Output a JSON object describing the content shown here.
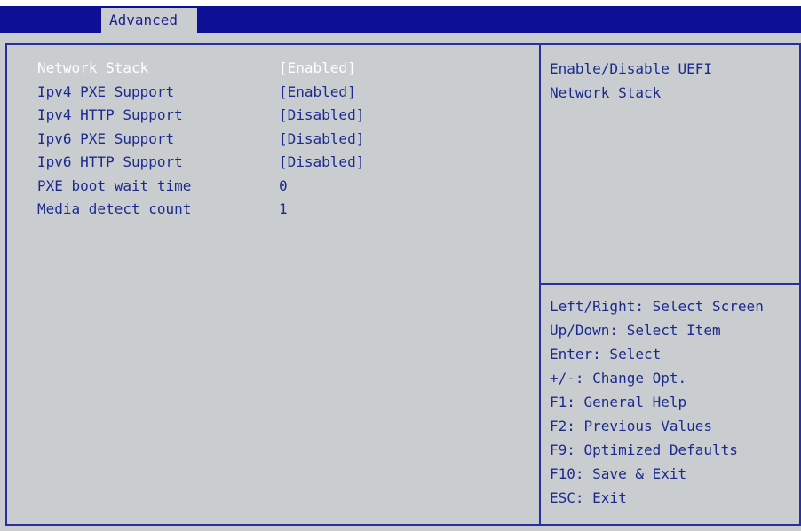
{
  "header": {
    "active_tab": "Advanced"
  },
  "settings": [
    {
      "label": "Network Stack",
      "value": "[Enabled]",
      "selected": true
    },
    {
      "label": "Ipv4 PXE Support",
      "value": "[Enabled]"
    },
    {
      "label": "Ipv4 HTTP Support",
      "value": "[Disabled]"
    },
    {
      "label": "Ipv6 PXE Support",
      "value": "[Disabled]"
    },
    {
      "label": "Ipv6 HTTP Support",
      "value": "[Disabled]"
    },
    {
      "label": "PXE boot wait time",
      "value": "0"
    },
    {
      "label": "Media detect count",
      "value": "1"
    }
  ],
  "help": {
    "line1": "Enable/Disable UEFI",
    "line2": "Network Stack"
  },
  "keys": [
    "Left/Right: Select Screen",
    "Up/Down: Select Item",
    "Enter: Select",
    "+/-: Change Opt.",
    "F1: General Help",
    "F2: Previous Values",
    "F9: Optimized Defaults",
    "F10: Save & Exit",
    "ESC: Exit"
  ],
  "colors": {
    "bar": "#0d0f95",
    "background": "#c9cdd0",
    "text": "#1b2a8e",
    "selected": "#ffffff"
  }
}
